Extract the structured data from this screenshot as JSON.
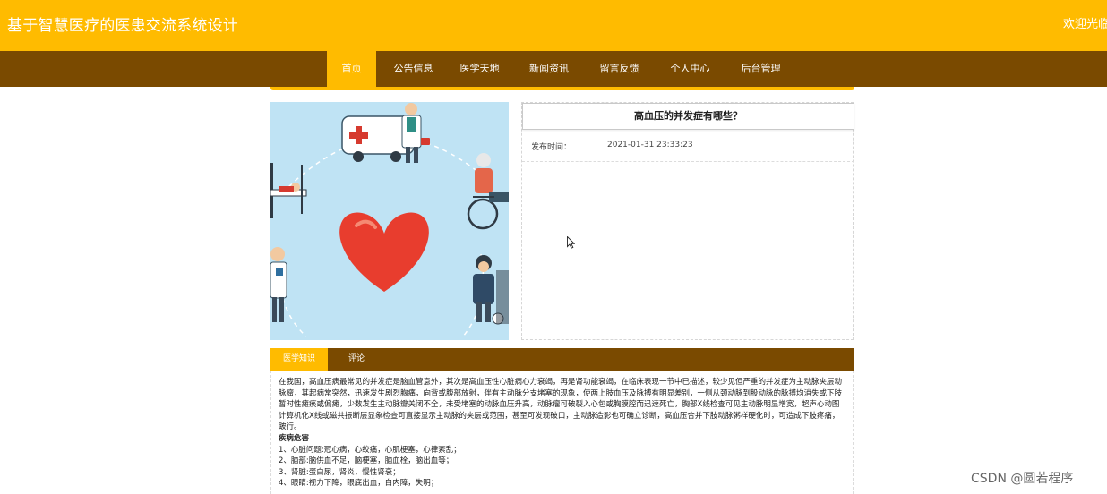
{
  "header": {
    "site_title": "基于智慧医疗的医患交流系统设计",
    "welcome": "欢迎光临"
  },
  "nav": {
    "items": [
      {
        "label": "首页",
        "active": true
      },
      {
        "label": "公告信息"
      },
      {
        "label": "医学天地"
      },
      {
        "label": "新闻资讯"
      },
      {
        "label": "留言反馈"
      },
      {
        "label": "个人中心"
      },
      {
        "label": "后台管理"
      }
    ]
  },
  "article": {
    "title": "高血压的并发症有哪些？",
    "publish_label": "发布时间：",
    "publish_time": "2021-01-31 23:33:23"
  },
  "tabs": [
    {
      "label": "医学知识",
      "active": true
    },
    {
      "label": "评论"
    }
  ],
  "content": {
    "paragraph": "在我国，高血压病最常见的并发症是脑血管意外，其次是高血压性心脏病心力衰竭，再是肾功能衰竭，在临床表现一节中已描述，较少见但严重的并发症为主动脉夹层动脉瘤，其起病常突然，迅速发生剧烈胸痛，向背或腹部放射，伴有主动脉分支堵塞的现象，使两上肢血压及脉搏有明显差别，一侧从颈动脉到股动脉的脉搏均消失或下肢暂时性瘫痪或偏瘫，少数发生主动脉瓣关闭不全，未受堵塞的动脉血压升高，动脉瘤可破裂入心包或胸膜腔而迅速死亡，胸部X线检查可见主动脉明显增宽，超声心动图计算机化X线或磁共振断层显象检查可直接显示主动脉的夹层或范围，甚至可发现破口，主动脉造影也可确立诊断，高血压合并下肢动脉粥样硬化时，可造成下肢疼痛，跛行。",
    "subheading": "疾病危害",
    "list": [
      "1、心脏问题:冠心病，心绞痛，心肌梗塞，心律紊乱；",
      "2、脑部:脑供血不足，脑梗塞，脑血栓，脑出血等；",
      "3、肾脏:蛋白尿，肾炎，慢性肾衰；",
      "4、眼睛:视力下降，眼底出血，白内障，失明；"
    ]
  },
  "watermark": "CSDN @圆若程序",
  "colors": {
    "header_bg": "#ffbb00",
    "nav_bg": "#7a4a00",
    "accent": "#ffbb00"
  },
  "icons": [
    "ambulance-icon",
    "doctor-icon",
    "heart-icon",
    "wheelchair-icon",
    "nurse-icon",
    "hospital-bed-icon",
    "mouse-cursor-icon"
  ]
}
